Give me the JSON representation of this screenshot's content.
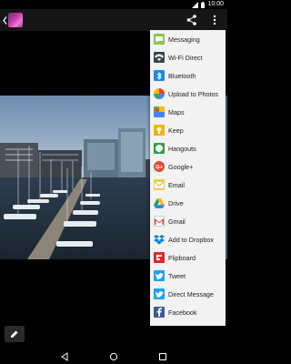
{
  "status_bar": {
    "time": "10:00"
  },
  "app_bar": {
    "back_icon": "back-arrow-icon",
    "share_icon": "share-icon",
    "overflow_icon": "more-vert-icon"
  },
  "share_menu": {
    "items": [
      {
        "label": "Messaging",
        "icon": "messaging-icon",
        "color": "#8bc34a"
      },
      {
        "label": "Wi-Fi Direct",
        "icon": "wifi-icon",
        "color": "#37474f"
      },
      {
        "label": "Bluetooth",
        "icon": "bluetooth-icon",
        "color": "#1e88e5"
      },
      {
        "label": "Upload to Photos",
        "icon": "photos-icon",
        "color": "#f4b400"
      },
      {
        "label": "Maps",
        "icon": "maps-icon",
        "color": "#4caf50"
      },
      {
        "label": "Keep",
        "icon": "keep-icon",
        "color": "#f6b400"
      },
      {
        "label": "Hangouts",
        "icon": "hangouts-icon",
        "color": "#2e9e4a"
      },
      {
        "label": "Google+",
        "icon": "google-plus-icon",
        "color": "#dd4b39"
      },
      {
        "label": "Email",
        "icon": "email-icon",
        "color": "#f2c94c"
      },
      {
        "label": "Drive",
        "icon": "drive-icon",
        "color": "#1fa463"
      },
      {
        "label": "Gmail",
        "icon": "gmail-icon",
        "color": "#db4437"
      },
      {
        "label": "Add to Dropbox",
        "icon": "dropbox-icon",
        "color": "#007ee5"
      },
      {
        "label": "Flipboard",
        "icon": "flipboard-icon",
        "color": "#e12828"
      },
      {
        "label": "Tweet",
        "icon": "twitter-icon",
        "color": "#1da1f2"
      },
      {
        "label": "Direct Message",
        "icon": "twitter-dm-icon",
        "color": "#1da1f2"
      },
      {
        "label": "Facebook",
        "icon": "facebook-icon",
        "color": "#3b5998"
      }
    ]
  },
  "edit_button": {
    "icon": "edit-pencil-icon"
  },
  "nav_bar": {
    "back_icon": "nav-back-icon",
    "home_icon": "nav-home-icon",
    "recents_icon": "nav-recents-icon"
  }
}
